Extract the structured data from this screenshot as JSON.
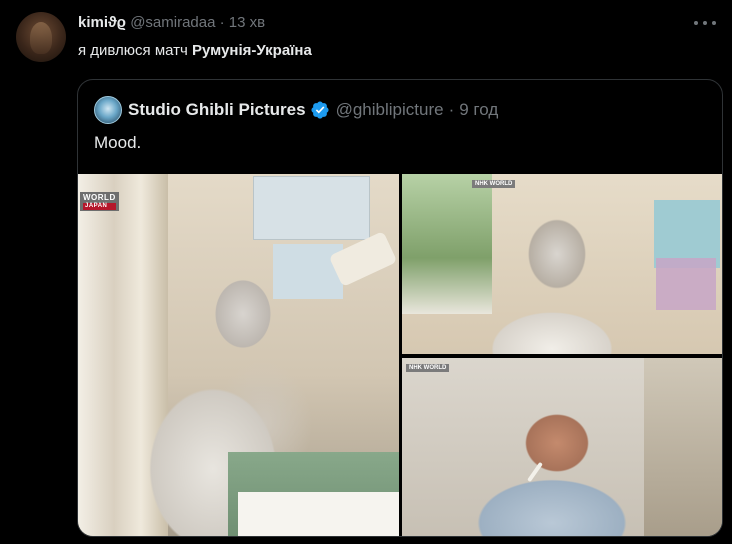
{
  "tweet": {
    "author_name": "kimiϑϱ",
    "handle": "@samiradaa",
    "separator": "·",
    "time": "13 хв",
    "text_plain": "я дивлюся матч ",
    "text_bold": "Румунія-Україна"
  },
  "quote": {
    "author_name": "Studio Ghibli Pictures",
    "handle": "@ghiblipicture",
    "separator": "·",
    "time": "9 год",
    "text": "Mood.",
    "verified_color": "#1d9bf0",
    "media": {
      "badge_top": "WORLD",
      "badge_bottom": "JAPAN",
      "badge_small": "NHK WORLD"
    }
  },
  "icons": [
    "more-icon",
    "verified-badge-icon"
  ],
  "colors": {
    "background": "#000000",
    "text_primary": "#e7e9ea",
    "text_secondary": "#71767b",
    "border": "#2f3336"
  }
}
